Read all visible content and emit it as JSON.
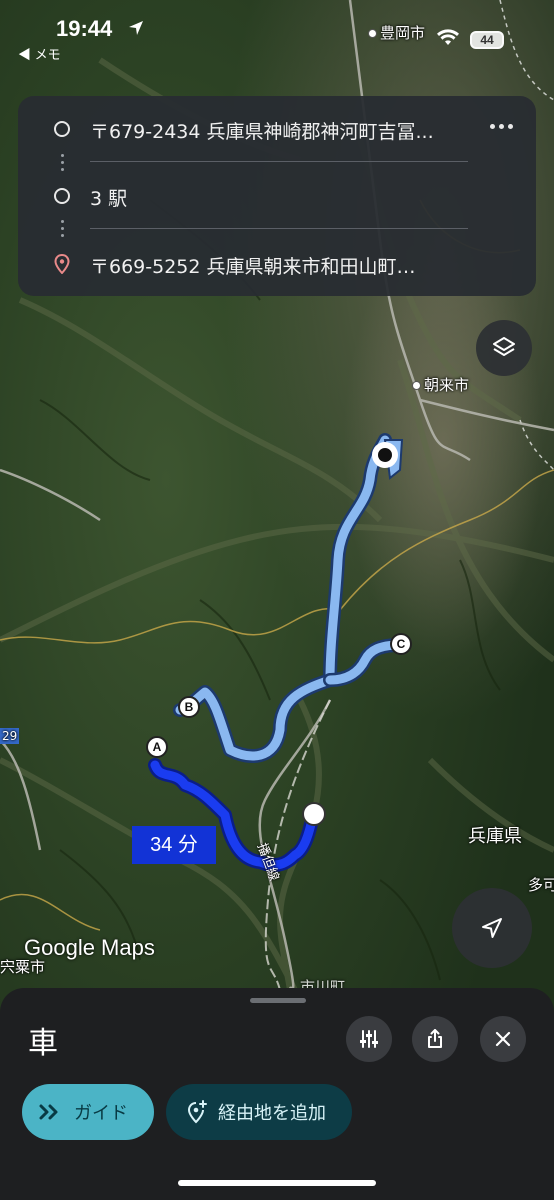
{
  "status_bar": {
    "time": "19:44",
    "back_label": "◀ メモ",
    "battery": "44"
  },
  "route_card": {
    "origin": "〒679-2434 兵庫県神崎郡神河町吉冨...",
    "stop": "3 駅",
    "destination": "〒669-5252 兵庫県朝来市和田山町…",
    "more_icon": "more-horizontal-icon",
    "colors": {
      "destination_pin": "#e98a8a"
    }
  },
  "map": {
    "labels": {
      "toyooka": "豊岡市",
      "asago": "朝来市",
      "hyogo": "兵庫県",
      "shiso": "宍粟市",
      "bantan": "播但線",
      "ta": "多可",
      "ichikawa": "市川町",
      "edge_num": "29"
    },
    "waypoints": {
      "a": "A",
      "b": "B",
      "c": "C"
    },
    "duration": "34 分",
    "logo": "Google Maps",
    "colors": {
      "route_main": "#1a3cf0",
      "route_alt": "#8ab8f0"
    }
  },
  "bottom_sheet": {
    "mode": "車",
    "guide_label": "ガイド",
    "add_stop_label": "経由地を追加",
    "icons": [
      "tune-icon",
      "share-icon",
      "close-icon"
    ]
  }
}
